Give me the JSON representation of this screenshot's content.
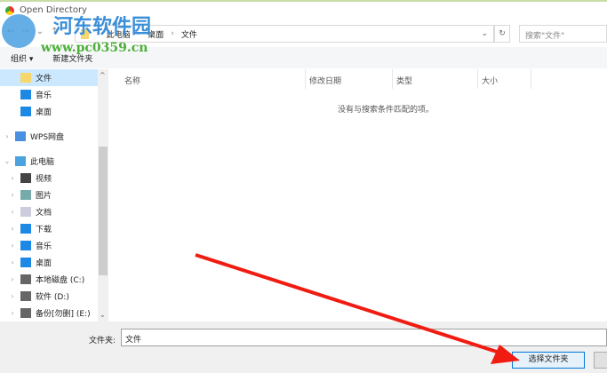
{
  "window": {
    "title": "Open Directory"
  },
  "watermark": {
    "name": "河东软件园",
    "url": "www.pc0359.cn"
  },
  "address": {
    "crumbs": [
      "此电脑",
      "桌面",
      "文件"
    ],
    "search_placeholder": "搜索\"文件\""
  },
  "toolbar": {
    "organize": "组织 ▾",
    "new_folder": "新建文件夹"
  },
  "sidebar": {
    "items": [
      {
        "label": "文件",
        "icon": "folder-icon",
        "color": "#f5d76e",
        "indent": 1,
        "chev": "",
        "sel": true
      },
      {
        "label": "音乐",
        "icon": "music-icon",
        "color": "#1e88e5",
        "indent": 1,
        "chev": ""
      },
      {
        "label": "桌面",
        "icon": "desktop-icon",
        "color": "#1e88e5",
        "indent": 1,
        "chev": ""
      },
      {
        "label": "",
        "icon": "",
        "color": "",
        "indent": 0,
        "chev": ""
      },
      {
        "label": "WPS网盘",
        "icon": "cloud-icon",
        "color": "#4a90e2",
        "indent": 0,
        "chev": "›"
      },
      {
        "label": "",
        "icon": "",
        "color": "",
        "indent": 0,
        "chev": ""
      },
      {
        "label": "此电脑",
        "icon": "computer-icon",
        "color": "#4aa3df",
        "indent": 0,
        "chev": "⌄"
      },
      {
        "label": "视频",
        "icon": "video-icon",
        "color": "#444",
        "indent": 1,
        "chev": "›"
      },
      {
        "label": "图片",
        "icon": "picture-icon",
        "color": "#7aa",
        "indent": 1,
        "chev": "›"
      },
      {
        "label": "文档",
        "icon": "document-icon",
        "color": "#ccd",
        "indent": 1,
        "chev": "›"
      },
      {
        "label": "下载",
        "icon": "download-icon",
        "color": "#1e88e5",
        "indent": 1,
        "chev": "›"
      },
      {
        "label": "音乐",
        "icon": "music-icon",
        "color": "#1e88e5",
        "indent": 1,
        "chev": "›"
      },
      {
        "label": "桌面",
        "icon": "desktop-icon",
        "color": "#1e88e5",
        "indent": 1,
        "chev": "›"
      },
      {
        "label": "本地磁盘 (C:)",
        "icon": "drive-icon",
        "color": "#666",
        "indent": 1,
        "chev": "›"
      },
      {
        "label": "软件 (D:)",
        "icon": "drive-icon",
        "color": "#666",
        "indent": 1,
        "chev": "›"
      },
      {
        "label": "备份[勿删] (E:)",
        "icon": "drive-icon",
        "color": "#666",
        "indent": 1,
        "chev": "›"
      }
    ]
  },
  "columns": [
    "名称",
    "修改日期",
    "类型",
    "大小"
  ],
  "empty_message": "没有与搜索条件匹配的项。",
  "footer": {
    "folder_label": "文件夹:",
    "folder_value": "文件",
    "select_button": "选择文件夹"
  }
}
